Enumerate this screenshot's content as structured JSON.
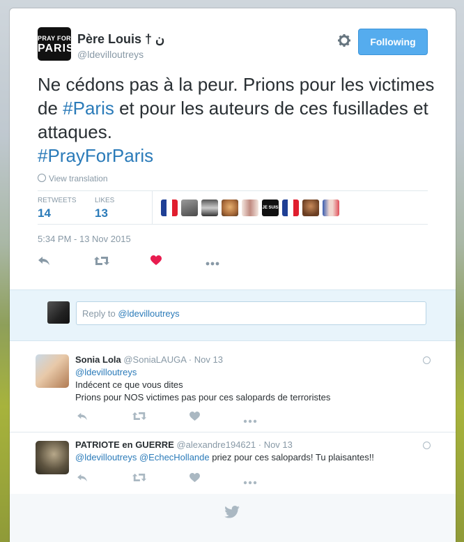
{
  "author": {
    "avatar_line1": "PRAY FOR",
    "avatar_line2": "PARIS",
    "name": "Père Louis † ن",
    "handle": "@ldevilloutreys"
  },
  "follow_button": "Following",
  "tweet": {
    "t1": "Ne cédons pas à la peur. Prions pour les victimes de ",
    "tag1": "#Paris",
    "t2": " et pour les auteurs de ces fusillades et attaques.",
    "tag2": "#PrayForParis"
  },
  "translate_label": "View translation",
  "stats": {
    "retweets_label": "RETWEETS",
    "retweets": "14",
    "likes_label": "LIKES",
    "likes": "13"
  },
  "liker_tile_text": "JE SUIS",
  "timestamp": "5:34 PM - 13 Nov 2015",
  "icons": {
    "reply": "reply-icon",
    "retweet": "retweet-icon",
    "like": "heart-icon",
    "more": "more-icon",
    "gear": "gear-icon",
    "bird": "twitter-bird-icon"
  },
  "colors": {
    "link": "#2b7bb9",
    "follow": "#55acee",
    "heart": "#e81c4f",
    "muted": "#8899a6"
  },
  "reply_box": {
    "prefix": "Reply to ",
    "mention": "@ldevilloutreys"
  },
  "replies": [
    {
      "name": "Sonia Lola",
      "handle": "@SoniaLAUGA",
      "date": "· Nov 13",
      "mention": "@ldevilloutreys",
      "line2": "Indécent ce que vous dites",
      "line3": "Prions pour NOS victimes pas pour ces salopards  de terroristes"
    },
    {
      "name": "PATRIOTE en GUERRE",
      "handle": "@alexandre194621",
      "date": "· Nov 13",
      "mention1": "@ldevilloutreys",
      "mention2": "@EchecHollande",
      "text": "  priez pour ces salopards! Tu plaisantes!!"
    }
  ]
}
